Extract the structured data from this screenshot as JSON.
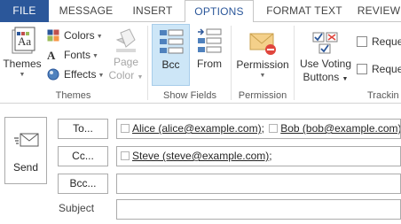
{
  "tabs": {
    "file": "FILE",
    "message": "MESSAGE",
    "insert": "INSERT",
    "options": "OPTIONS",
    "format_text": "FORMAT TEXT",
    "review": "REVIEW"
  },
  "ribbon": {
    "themes_group": {
      "themes_label": "Themes",
      "colors_label": "Colors",
      "fonts_label": "Fonts",
      "effects_label": "Effects",
      "page_color_line1": "Page",
      "page_color_line2": "Color",
      "group_label": "Themes"
    },
    "show_fields_group": {
      "bcc_label": "Bcc",
      "from_label": "From",
      "group_label": "Show Fields"
    },
    "permission_group": {
      "permission_label": "Permission",
      "group_label": "Permission"
    },
    "tracking_group": {
      "voting_line1": "Use Voting",
      "voting_line2": "Buttons",
      "request1_label": "Reque",
      "request2_label": "Reque",
      "group_label": "Trackin"
    }
  },
  "compose": {
    "send_label": "Send",
    "to_button": "To...",
    "cc_button": "Cc...",
    "bcc_button": "Bcc...",
    "subject_label": "Subject",
    "to_recipients": [
      "Alice (alice@example.com)",
      "Bob (bob@example.com)"
    ],
    "cc_recipients": [
      "Steve (steve@example.com)"
    ],
    "bcc_value": "",
    "subject_value": ""
  },
  "colors": {
    "file_tab": "#2b579a",
    "active_tab_text": "#2b579a",
    "bcc_highlight": "#cde6f7",
    "permission_accent": "#e0463d"
  }
}
